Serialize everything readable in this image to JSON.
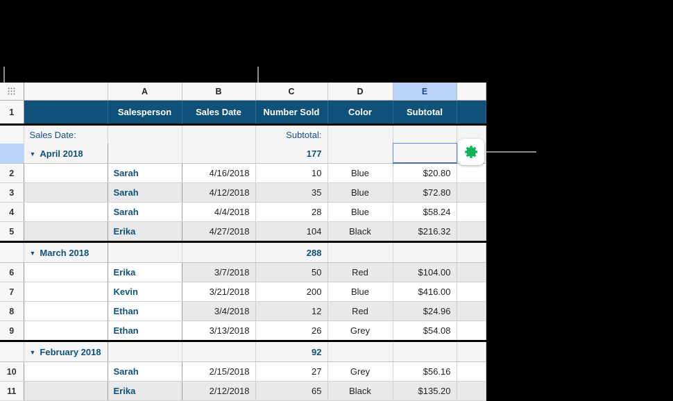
{
  "app": {
    "corner_icon": "grid-dots-icon",
    "gear_icon": "gear-icon",
    "accent_header_color": "#0f5179",
    "selection_color": "#b9d2f5",
    "gear_color": "#12b257"
  },
  "columns": {
    "letters": [
      "",
      "A",
      "B",
      "C",
      "D",
      "E",
      ""
    ],
    "selected_letter": "E"
  },
  "header_row": {
    "number": "1",
    "cells": [
      "",
      "Salesperson",
      "Sales Date",
      "Number Sold",
      "Color",
      "Subtotal",
      ""
    ]
  },
  "label_row": {
    "category_label": "Sales Date:",
    "subtotal_label": "Subtotal:"
  },
  "groups": [
    {
      "name": "April 2018",
      "subtotal": "177",
      "caret": "▼",
      "selected": true,
      "rows": [
        {
          "num": "2",
          "salesperson": "Sarah",
          "date": "4/16/2018",
          "sold": "10",
          "color": "Blue",
          "subtotal": "$20.80"
        },
        {
          "num": "3",
          "salesperson": "Sarah",
          "date": "4/12/2018",
          "sold": "35",
          "color": "Blue",
          "subtotal": "$72.80"
        },
        {
          "num": "4",
          "salesperson": "Sarah",
          "date": "4/4/2018",
          "sold": "28",
          "color": "Blue",
          "subtotal": "$58.24"
        },
        {
          "num": "5",
          "salesperson": "Erika",
          "date": "4/27/2018",
          "sold": "104",
          "color": "Black",
          "subtotal": "$216.32"
        }
      ]
    },
    {
      "name": "March 2018",
      "subtotal": "288",
      "caret": "▼",
      "selected": false,
      "rows": [
        {
          "num": "6",
          "salesperson": "Erika",
          "date": "3/7/2018",
          "sold": "50",
          "color": "Red",
          "subtotal": "$104.00"
        },
        {
          "num": "7",
          "salesperson": "Kevin",
          "date": "3/21/2018",
          "sold": "200",
          "color": "Blue",
          "subtotal": "$416.00"
        },
        {
          "num": "8",
          "salesperson": "Ethan",
          "date": "3/4/2018",
          "sold": "12",
          "color": "Red",
          "subtotal": "$24.96"
        },
        {
          "num": "9",
          "salesperson": "Ethan",
          "date": "3/13/2018",
          "sold": "26",
          "color": "Grey",
          "subtotal": "$54.08"
        }
      ]
    },
    {
      "name": "February 2018",
      "subtotal": "92",
      "caret": "▼",
      "selected": false,
      "rows": [
        {
          "num": "10",
          "salesperson": "Sarah",
          "date": "2/15/2018",
          "sold": "27",
          "color": "Grey",
          "subtotal": "$56.16"
        },
        {
          "num": "11",
          "salesperson": "Erika",
          "date": "2/12/2018",
          "sold": "65",
          "color": "Black",
          "subtotal": "$135.20"
        }
      ]
    }
  ]
}
